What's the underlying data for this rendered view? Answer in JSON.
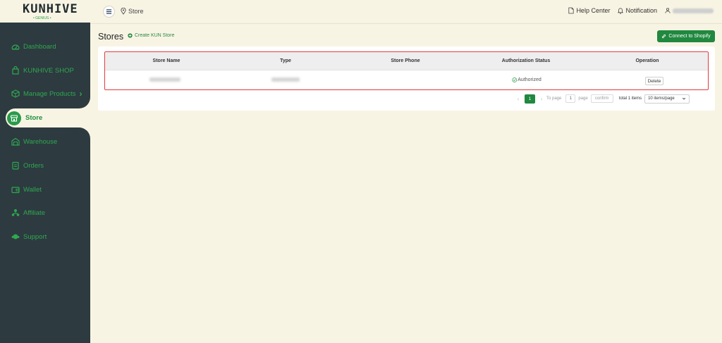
{
  "app": {
    "logo_text": "KUNHIVE",
    "logo_sub": "• GENIUS •"
  },
  "sidebar": {
    "items": [
      {
        "label": "Dashboard",
        "icon": "dashboard-icon"
      },
      {
        "label": "KUNHIVE SHOP",
        "icon": "bag-icon"
      },
      {
        "label": "Manage Products",
        "icon": "box-icon",
        "chevron": "›"
      },
      {
        "label": "Store",
        "icon": "store-icon",
        "active": true
      },
      {
        "label": "Warehouse",
        "icon": "warehouse-icon"
      },
      {
        "label": "Orders",
        "icon": "orders-icon"
      },
      {
        "label": "Wallet",
        "icon": "wallet-icon"
      },
      {
        "label": "Affiliate",
        "icon": "affiliate-icon"
      },
      {
        "label": "Support",
        "icon": "support-icon"
      }
    ]
  },
  "topbar": {
    "breadcrumb": "Store",
    "help_center": "Help Center",
    "notification": "Notification"
  },
  "page": {
    "title": "Stores",
    "create_link": "Create KUN Store",
    "connect_button": "Connect to Shopify"
  },
  "table": {
    "columns": [
      "Store Name",
      "Type",
      "Store Phone",
      "Authorization Status",
      "Operation"
    ],
    "rows": [
      {
        "authorization_status": "Authorized",
        "operation": "Delete"
      }
    ]
  },
  "pagination": {
    "current_page": "1",
    "to_page_label": "To page",
    "page_input_value": "1",
    "page_label": "page",
    "confirm_label": "confirm",
    "total": "total 1 items",
    "page_size": "10 items/page"
  },
  "colors": {
    "sidebar_bg": "#2d3a40",
    "accent": "#20883f",
    "page_bg": "#f8f4e4",
    "highlight_border": "#e23b3b"
  }
}
